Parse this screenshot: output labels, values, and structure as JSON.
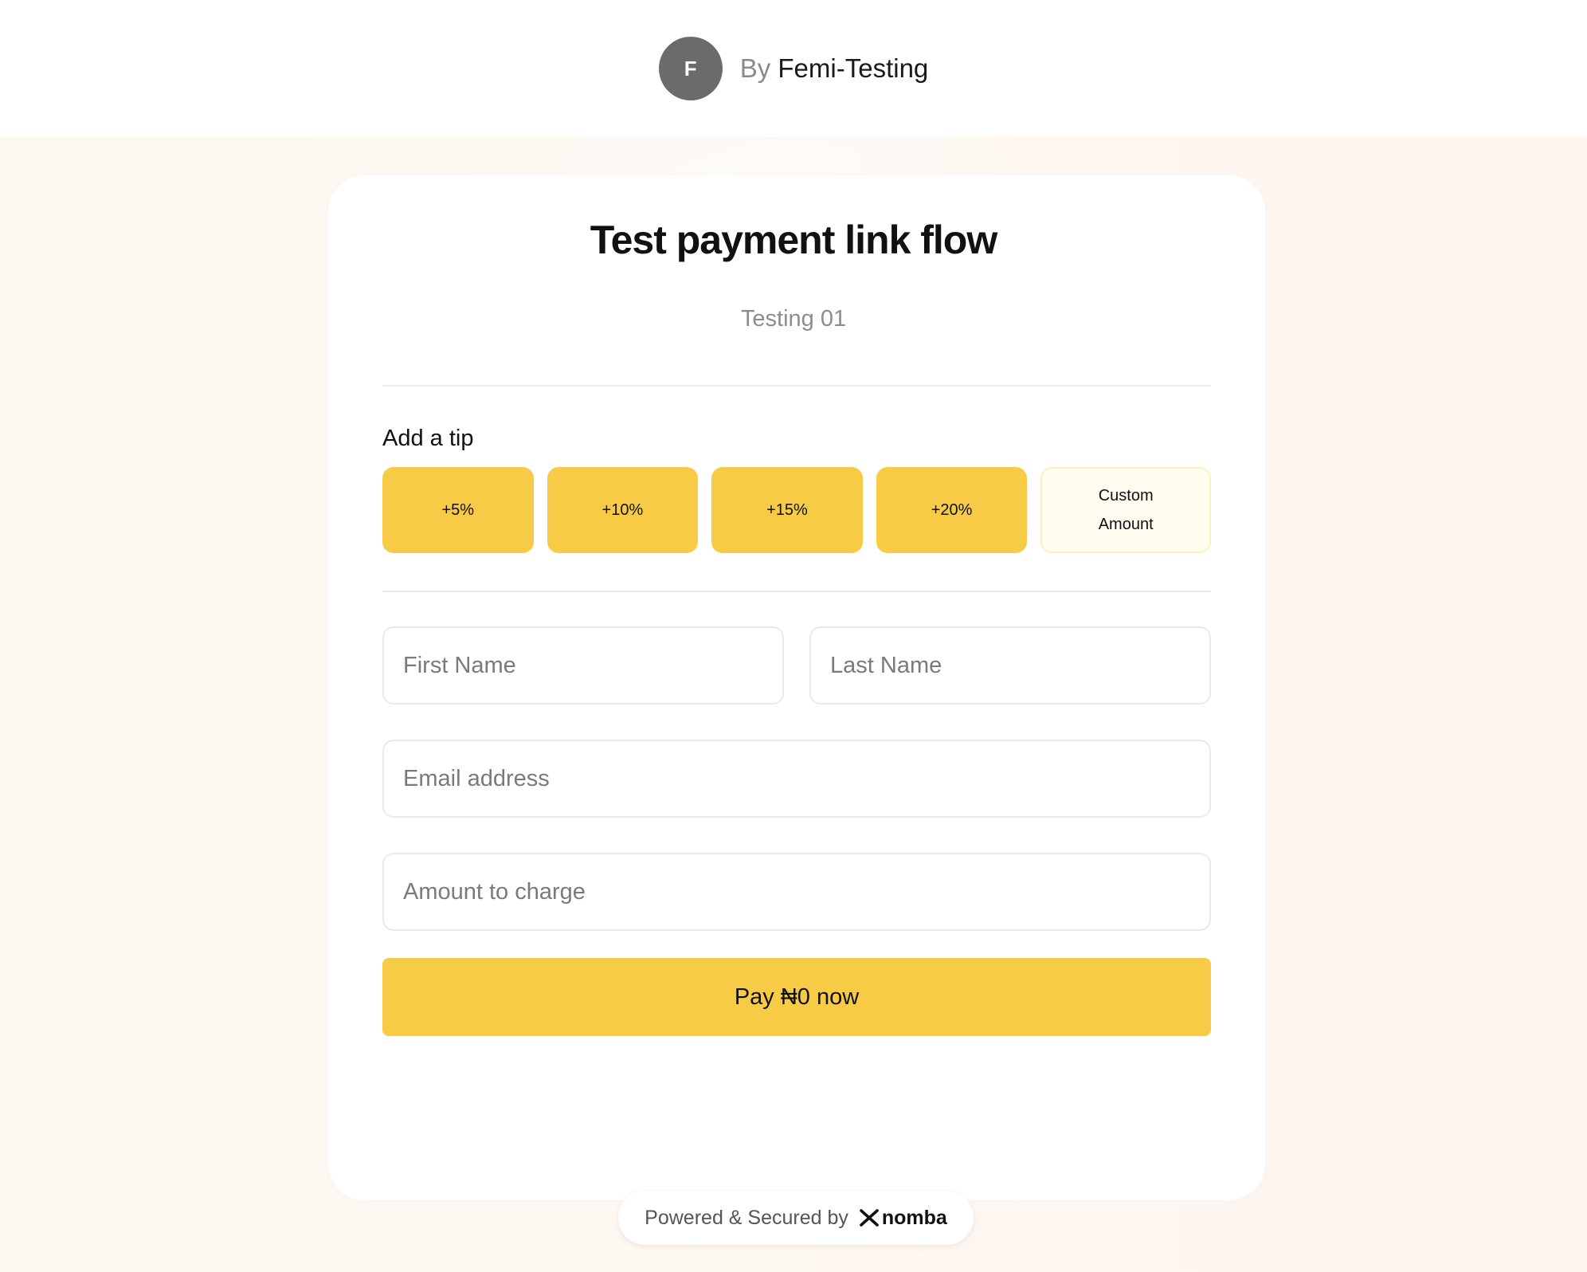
{
  "header": {
    "avatar_initial": "F",
    "by_label": "By",
    "merchant_name": "Femi-Testing"
  },
  "card": {
    "title": "Test payment link flow",
    "subtitle": "Testing 01",
    "tip_label": "Add a tip",
    "tips": [
      {
        "label": "+5%"
      },
      {
        "label": "+10%"
      },
      {
        "label": "+15%"
      },
      {
        "label": "+20%"
      }
    ],
    "custom_tip": {
      "line1": "Custom",
      "line2": "Amount"
    }
  },
  "form": {
    "first_name": {
      "placeholder": "First Name",
      "value": ""
    },
    "last_name": {
      "placeholder": "Last Name",
      "value": ""
    },
    "email": {
      "placeholder": "Email address",
      "value": ""
    },
    "amount": {
      "placeholder": "Amount to charge",
      "value": ""
    },
    "pay_button_label": "Pay ₦0 now"
  },
  "footer": {
    "powered_label": "Powered & Secured by",
    "brand_name": "nomba",
    "brand_icon": "nomba-x-icon"
  },
  "colors": {
    "accent": "#f7cb45",
    "avatar_bg": "#6b6b6b",
    "custom_tip_bg": "#fffcf0"
  }
}
